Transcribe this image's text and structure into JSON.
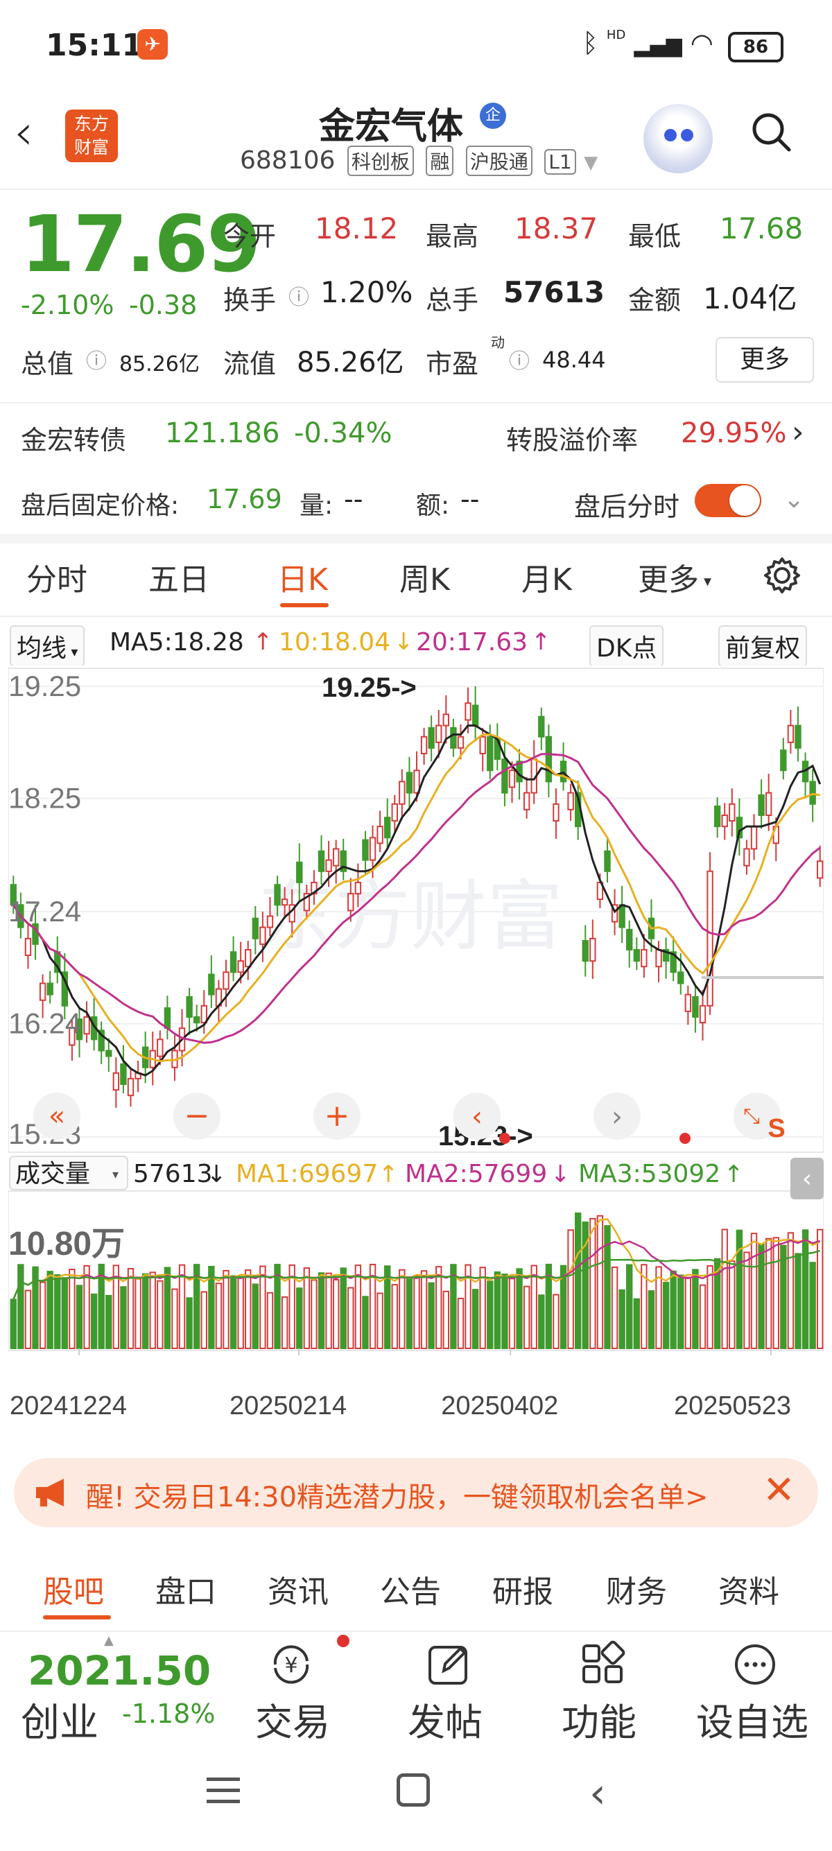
{
  "status_bar": {
    "time": "15:11",
    "network": "HD",
    "battery": "86"
  },
  "header": {
    "logo_line1": "东方",
    "logo_line2": "财富",
    "stock_name": "金宏气体",
    "name_badge": "企",
    "code": "688106",
    "tags": [
      "科创板",
      "融",
      "沪股通",
      "L1"
    ]
  },
  "quote": {
    "price": "17.69",
    "change_pct": "-2.10%",
    "change_amt": "-0.38",
    "open_label": "今开",
    "open": "18.12",
    "high_label": "最高",
    "high": "18.37",
    "low_label": "最低",
    "low": "17.68",
    "turnover_label": "换手",
    "turnover": "1.20%",
    "volume_label": "总手",
    "volume": "57613",
    "amount_label": "金额",
    "amount": "1.04亿",
    "mktcap_label": "总值",
    "mktcap": "85.26亿",
    "float_label": "流值",
    "float_cap": "85.26亿",
    "pe_label": "市盈",
    "pe_sup": "动",
    "pe": "48.44",
    "more_label": "更多"
  },
  "bond": {
    "name": "金宏转债",
    "price": "121.186",
    "change": "-0.34%",
    "premium_label": "转股溢价率",
    "premium": "29.95%"
  },
  "after_hours": {
    "fixed_price_label": "盘后固定价格:",
    "fixed_price": "17.69",
    "volume_label": "量:",
    "volume": "--",
    "amount_label": "额:",
    "amount": "--",
    "timeshare_label": "盘后分时",
    "toggle_on": true
  },
  "period_tabs": [
    "分时",
    "五日",
    "日K",
    "周K",
    "月K",
    "更多"
  ],
  "active_period": "日K",
  "ma_row": {
    "selector": "均线",
    "ma5": "MA5:18.28",
    "ma10": "10:18.04",
    "ma20": "20:17.63",
    "dk_label": "DK点",
    "adjust_label": "前复权"
  },
  "chart_data": {
    "type": "candlestick",
    "y_ticks": [
      "19.25",
      "18.25",
      "17.24",
      "16.24",
      "15.23"
    ],
    "ylim": [
      15.23,
      19.25
    ],
    "annotations": [
      {
        "label": "19.25->",
        "value": 19.25
      },
      {
        "label": "15.23->",
        "value": 15.23
      }
    ],
    "x_ticks": [
      "20241224",
      "20250214",
      "20250402",
      "20250523"
    ],
    "watermark": "东方财富",
    "closes": [
      17.3,
      17.1,
      17.0,
      16.95,
      16.6,
      16.5,
      16.7,
      16.4,
      16.2,
      16.1,
      16.3,
      16.1,
      16.0,
      15.95,
      15.8,
      15.7,
      15.75,
      15.8,
      15.85,
      16.0,
      16.1,
      16.2,
      16.0,
      16.2,
      16.3,
      16.25,
      16.4,
      16.5,
      16.55,
      16.7,
      16.7,
      16.8,
      16.9,
      17.0,
      17.1,
      17.2,
      17.3,
      17.35,
      17.3,
      17.5,
      17.4,
      17.5,
      17.6,
      17.7,
      17.8,
      17.6,
      17.4,
      17.5,
      17.7,
      17.9,
      18.0,
      17.9,
      18.2,
      18.4,
      18.3,
      18.5,
      18.8,
      18.7,
      18.9,
      19.0,
      18.7,
      18.8,
      19.1,
      18.9,
      18.8,
      18.5,
      18.6,
      18.3,
      18.5,
      18.4,
      18.3,
      18.6,
      18.8,
      18.4,
      18.2,
      18.4,
      18.3,
      18.0,
      16.8,
      17.0,
      17.5,
      17.6,
      17.3,
      17.1,
      16.9,
      16.8,
      16.9,
      17.0,
      16.9,
      16.8,
      16.7,
      16.6,
      16.5,
      16.3,
      16.4,
      17.6,
      18.0,
      18.1,
      18.2,
      17.9,
      17.8,
      18.0,
      18.1,
      18.3,
      18.0,
      18.5,
      18.9,
      18.7,
      18.4,
      18.2,
      17.69
    ],
    "ma_series": [
      {
        "name": "MA5",
        "color": "#222222"
      },
      {
        "name": "MA10",
        "color": "#e8b020"
      },
      {
        "name": "MA20",
        "color": "#c0308c"
      }
    ],
    "up_color": "#d63a3a",
    "down_color": "#3f9a2d"
  },
  "chart_controls": {
    "zoom_out": "−",
    "zoom_in": "+",
    "s_label": "S"
  },
  "volume_row": {
    "selector": "成交量",
    "value": "57613",
    "ma1": "MA1:69697",
    "ma2": "MA2:57699",
    "ma3": "MA3:53092",
    "max_label": "10.80万"
  },
  "banner": {
    "text": "醒! 交易日14:30精选潜力股，一键领取机会名单>"
  },
  "bottom_tabs": [
    "股吧",
    "盘口",
    "资讯",
    "公告",
    "研报",
    "财务",
    "资料"
  ],
  "active_bottom_tab": "股吧",
  "toolbar": {
    "index_value": "2021.50",
    "index_name": "创业",
    "index_change": "-1.18%",
    "trade": "交易",
    "post": "发帖",
    "functions": "功能",
    "watchlist": "设自选"
  },
  "colors": {
    "accent": "#e8541f",
    "up": "#d63a3a",
    "down": "#3f9a2d"
  }
}
